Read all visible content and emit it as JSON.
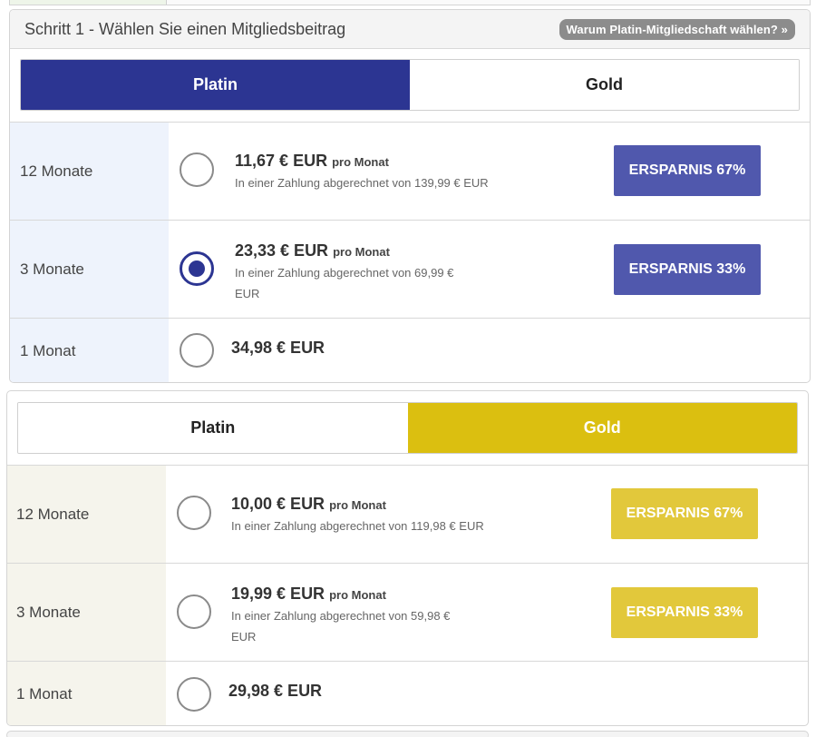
{
  "step": {
    "title": "Schritt 1 - Wählen Sie einen Mitgliedsbeitrag",
    "why_link": "Warum Platin-Mitgliedschaft wählen? »"
  },
  "tabs": {
    "platin": "Platin",
    "gold": "Gold"
  },
  "colors": {
    "platin_accent": "#2c3592",
    "gold_accent": "#dbbf10"
  },
  "platin_panel": {
    "active_tab": "Platin",
    "plans": [
      {
        "duration": "12 Monate",
        "price": "11,67 € EUR",
        "per": "pro Monat",
        "billing": "In einer Zahlung abgerechnet von 139,99 € EUR",
        "badge": "ERSPARNIS 67%",
        "selected": false
      },
      {
        "duration": "3 Monate",
        "price": "23,33 € EUR",
        "per": "pro Monat",
        "billing_line1": "In einer Zahlung abgerechnet von 69,99 €",
        "billing_line2": "EUR",
        "badge": "ERSPARNIS 33%",
        "selected": true
      },
      {
        "duration": "1 Monat",
        "price": "34,98 € EUR",
        "selected": false
      }
    ]
  },
  "gold_panel": {
    "active_tab": "Gold",
    "plans": [
      {
        "duration": "12 Monate",
        "price": "10,00 € EUR",
        "per": "pro Monat",
        "billing": "In einer Zahlung abgerechnet von 119,98 € EUR",
        "badge": "ERSPARNIS 67%",
        "selected": false
      },
      {
        "duration": "3 Monate",
        "price": "19,99 € EUR",
        "per": "pro Monat",
        "billing_line1": "In einer Zahlung abgerechnet von 59,98 €",
        "billing_line2": "EUR",
        "badge": "ERSPARNIS 33%",
        "selected": false
      },
      {
        "duration": "1 Monat",
        "price": "29,98 € EUR",
        "selected": false
      }
    ]
  }
}
